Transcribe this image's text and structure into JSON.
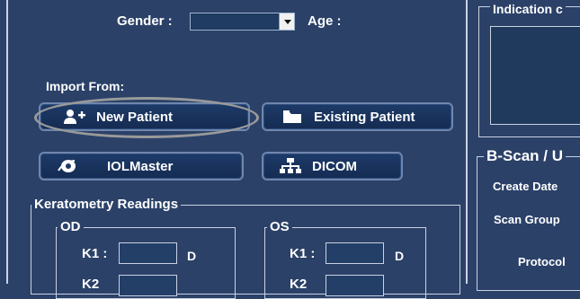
{
  "patient": {
    "gender_label": "Gender :",
    "gender_value": "",
    "age_label": "Age :"
  },
  "import": {
    "heading": "Import From:",
    "new_patient": "New Patient",
    "existing_patient": "Existing Patient",
    "iolmaster": "IOLMaster",
    "dicom": "DICOM"
  },
  "keratometry": {
    "title": "Keratometry Readings",
    "od": {
      "label": "OD",
      "k1_label": "K1 :",
      "k1_unit": "D",
      "k2_label": "K2"
    },
    "os": {
      "label": "OS",
      "k1_label": "K1 :",
      "k1_unit": "D",
      "k2_label": "K2"
    }
  },
  "right_panel": {
    "indication_title": "Indication c",
    "bscan_title": "B-Scan / U",
    "create_date_label": "Create Date",
    "scan_group_label": "Scan Group",
    "protocol_label": "Protocol"
  },
  "colors": {
    "background": "#2b4168",
    "button": "#1d3a68",
    "highlight_ellipse": "#9a9a9a"
  }
}
